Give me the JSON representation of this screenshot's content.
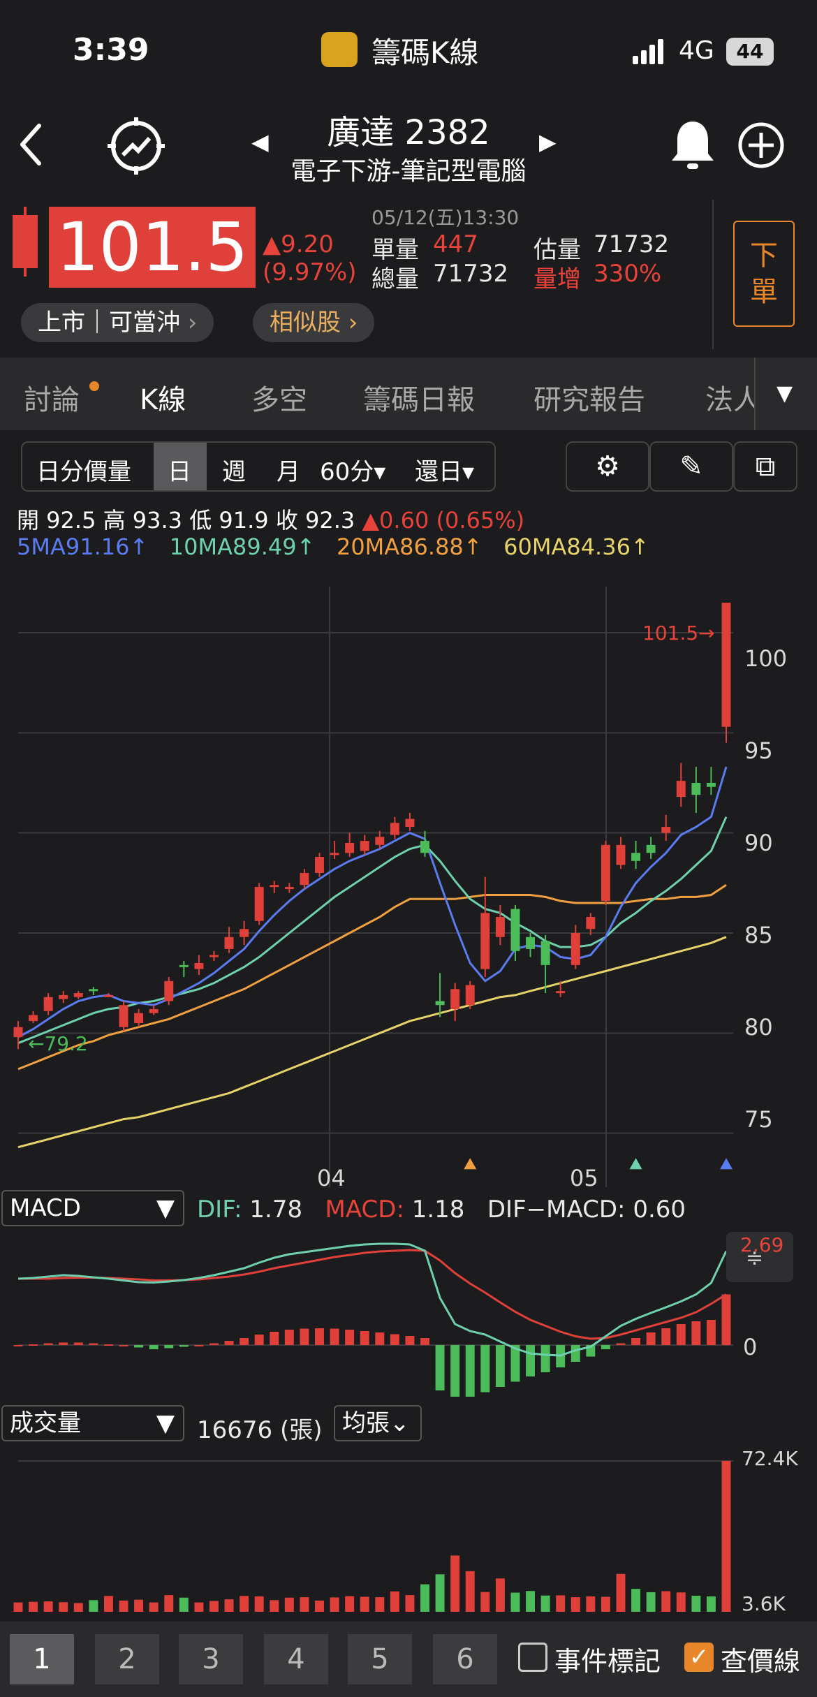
{
  "status_bar": {
    "time": "3:39",
    "app_name": "籌碼K線",
    "network": "4G",
    "battery": "44"
  },
  "header": {
    "stock_name": "廣達 2382",
    "industry": "電子下游-筆記型電腦"
  },
  "quote": {
    "price": "101.5",
    "change": "▲9.20",
    "change_pct": "(9.97%)",
    "datetime": "05/12(五)13:30",
    "single_vol_label": "單量",
    "single_vol": "447",
    "est_vol_label": "估量",
    "est_vol": "71732",
    "total_vol_label": "總量",
    "total_vol": "71732",
    "vol_increase_label": "量增",
    "vol_increase": "330%",
    "market_tag": "上市｜可當沖",
    "similar_label": "相似股",
    "order_button": "下單"
  },
  "tabs": [
    "討論",
    "K線",
    "多空",
    "籌碼日報",
    "研究報告",
    "法人"
  ],
  "toolbar": {
    "intraday": "日分價量",
    "day": "日",
    "week": "週",
    "month": "月",
    "minute": "60分▾",
    "restore": "還日▾"
  },
  "ohlc": {
    "open": "開 92.5",
    "high": "高 93.3",
    "low": "低 91.9",
    "close": "收 92.3",
    "change": "▲0.60 (0.65%)"
  },
  "ma_legend": {
    "ma5": "5MA91.16↑",
    "ma10": "10MA89.49↑",
    "ma20": "20MA86.88↑",
    "ma60": "60MA84.36↑"
  },
  "colors": {
    "up": "#e0403a",
    "down": "#4cbb5a",
    "ma5": "#5b7cf0",
    "ma10": "#6fd0b0",
    "ma20": "#f0a040",
    "ma60": "#e6d36a",
    "accent": "#e8862a"
  },
  "price_chart": {
    "y_ticks": [
      "100",
      "95",
      "90",
      "85",
      "80",
      "75"
    ],
    "x_ticks": [
      "04",
      "05"
    ],
    "last_price_marker": "101.5",
    "low_marker": "←79.2"
  },
  "macd": {
    "selector": "MACD",
    "dif_label": "DIF:",
    "dif_value": "1.78",
    "macd_label": "MACD:",
    "macd_value": "1.18",
    "diff_label": "DIF−MACD:",
    "diff_value": "0.60",
    "top_value": "2.69",
    "zero": "0"
  },
  "volume": {
    "selector": "成交量",
    "value": "16676 (張)",
    "unit_selector": "均張⌄",
    "max": "72.4K",
    "min": "3.6K"
  },
  "bottom": {
    "pages": [
      "1",
      "2",
      "3",
      "4",
      "5",
      "6"
    ],
    "event_marker": "事件標記",
    "price_line": "查價線"
  },
  "chart_data": {
    "type": "candlestick",
    "candles": [
      {
        "o": 79.8,
        "c": 80.3,
        "h": 80.6,
        "l": 79.2
      },
      {
        "o": 80.6,
        "c": 80.9,
        "h": 81.1,
        "l": 80.5
      },
      {
        "o": 81.1,
        "c": 81.8,
        "h": 82.0,
        "l": 80.9
      },
      {
        "o": 81.7,
        "c": 81.9,
        "h": 82.1,
        "l": 81.5
      },
      {
        "o": 81.8,
        "c": 82.0,
        "h": 82.1,
        "l": 81.7
      },
      {
        "o": 82.2,
        "c": 82.1,
        "h": 82.3,
        "l": 81.9
      },
      {
        "o": 81.9,
        "c": 81.9,
        "h": 82.0,
        "l": 81.8
      },
      {
        "o": 80.3,
        "c": 81.4,
        "h": 81.6,
        "l": 80.1
      },
      {
        "o": 80.5,
        "c": 81.0,
        "h": 81.2,
        "l": 80.3
      },
      {
        "o": 81.0,
        "c": 81.2,
        "h": 81.4,
        "l": 80.9
      },
      {
        "o": 81.6,
        "c": 82.6,
        "h": 82.8,
        "l": 81.4
      },
      {
        "o": 83.4,
        "c": 83.3,
        "h": 83.6,
        "l": 82.8
      },
      {
        "o": 83.2,
        "c": 83.5,
        "h": 83.9,
        "l": 82.9
      },
      {
        "o": 83.8,
        "c": 83.9,
        "h": 84.1,
        "l": 83.6
      },
      {
        "o": 84.2,
        "c": 84.8,
        "h": 85.3,
        "l": 84.0
      },
      {
        "o": 84.8,
        "c": 85.2,
        "h": 85.6,
        "l": 84.4
      },
      {
        "o": 85.6,
        "c": 87.3,
        "h": 87.5,
        "l": 85.4
      },
      {
        "o": 87.3,
        "c": 87.4,
        "h": 87.6,
        "l": 87.0
      },
      {
        "o": 87.2,
        "c": 87.3,
        "h": 87.5,
        "l": 87.0
      },
      {
        "o": 87.4,
        "c": 88.0,
        "h": 88.2,
        "l": 87.2
      },
      {
        "o": 88.0,
        "c": 88.8,
        "h": 89.0,
        "l": 87.8
      },
      {
        "o": 89.0,
        "c": 89.0,
        "h": 89.6,
        "l": 88.7
      },
      {
        "o": 89.0,
        "c": 89.5,
        "h": 90.0,
        "l": 88.8
      },
      {
        "o": 89.1,
        "c": 89.6,
        "h": 89.9,
        "l": 88.9
      },
      {
        "o": 89.4,
        "c": 89.8,
        "h": 90.1,
        "l": 89.2
      },
      {
        "o": 89.9,
        "c": 90.5,
        "h": 90.8,
        "l": 89.7
      },
      {
        "o": 90.3,
        "c": 90.7,
        "h": 91.0,
        "l": 90.1
      },
      {
        "o": 89.6,
        "c": 89.0,
        "h": 90.1,
        "l": 88.8
      },
      {
        "o": 81.6,
        "c": 81.4,
        "h": 83.0,
        "l": 80.8
      },
      {
        "o": 81.2,
        "c": 82.2,
        "h": 82.5,
        "l": 80.6
      },
      {
        "o": 81.4,
        "c": 82.4,
        "h": 82.6,
        "l": 81.2
      },
      {
        "o": 83.2,
        "c": 86.0,
        "h": 87.8,
        "l": 82.8
      },
      {
        "o": 84.8,
        "c": 85.8,
        "h": 86.4,
        "l": 84.4
      },
      {
        "o": 86.2,
        "c": 84.1,
        "h": 86.4,
        "l": 83.6
      },
      {
        "o": 84.8,
        "c": 84.2,
        "h": 85.0,
        "l": 83.8
      },
      {
        "o": 84.6,
        "c": 83.4,
        "h": 84.9,
        "l": 82.0
      },
      {
        "o": 82.0,
        "c": 82.1,
        "h": 82.6,
        "l": 81.8
      },
      {
        "o": 83.4,
        "c": 85.0,
        "h": 85.4,
        "l": 83.2
      },
      {
        "o": 85.2,
        "c": 85.8,
        "h": 86.0,
        "l": 84.9
      },
      {
        "o": 86.6,
        "c": 89.4,
        "h": 89.6,
        "l": 86.4
      },
      {
        "o": 88.4,
        "c": 89.4,
        "h": 89.8,
        "l": 88.2
      },
      {
        "o": 89.0,
        "c": 88.6,
        "h": 89.6,
        "l": 88.2
      },
      {
        "o": 89.4,
        "c": 89.0,
        "h": 89.8,
        "l": 88.7
      },
      {
        "o": 90.0,
        "c": 90.3,
        "h": 90.9,
        "l": 89.6
      },
      {
        "o": 91.8,
        "c": 92.6,
        "h": 93.5,
        "l": 91.3
      },
      {
        "o": 92.5,
        "c": 91.9,
        "h": 93.3,
        "l": 91.0
      },
      {
        "o": 92.5,
        "c": 92.3,
        "h": 93.3,
        "l": 91.9
      },
      {
        "o": 95.3,
        "c": 101.5,
        "h": 101.5,
        "l": 94.5
      }
    ],
    "ma5": [
      79.8,
      80.2,
      80.7,
      81.2,
      81.6,
      81.8,
      81.9,
      81.6,
      81.5,
      81.4,
      81.7,
      82.1,
      82.5,
      83.0,
      83.6,
      84.2,
      85.1,
      85.9,
      86.6,
      87.2,
      87.7,
      88.2,
      88.6,
      88.9,
      89.2,
      89.6,
      90.0,
      89.7,
      87.5,
      85.4,
      83.5,
      82.6,
      83.1,
      84.2,
      84.4,
      84.3,
      83.8,
      83.7,
      83.9,
      84.8,
      86.3,
      87.5,
      88.3,
      89.0,
      89.9,
      90.3,
      90.8,
      93.3
    ],
    "ma10": [
      79.5,
      79.8,
      80.1,
      80.4,
      80.7,
      81.0,
      81.2,
      81.3,
      81.5,
      81.6,
      81.8,
      82.0,
      82.2,
      82.5,
      82.9,
      83.3,
      83.8,
      84.4,
      85.0,
      85.6,
      86.2,
      86.8,
      87.3,
      87.8,
      88.3,
      88.8,
      89.2,
      89.4,
      88.6,
      87.6,
      86.7,
      86.2,
      86.0,
      85.5,
      85.1,
      84.6,
      84.3,
      84.3,
      84.4,
      84.8,
      85.5,
      86.0,
      86.6,
      87.1,
      87.7,
      88.4,
      89.1,
      90.8
    ],
    "ma20": [
      78.2,
      78.5,
      78.8,
      79.1,
      79.4,
      79.6,
      79.9,
      80.1,
      80.3,
      80.5,
      80.7,
      81.0,
      81.3,
      81.6,
      81.9,
      82.2,
      82.6,
      83.0,
      83.4,
      83.8,
      84.2,
      84.6,
      85.0,
      85.4,
      85.8,
      86.3,
      86.7,
      86.7,
      86.7,
      86.7,
      86.8,
      86.9,
      86.9,
      86.9,
      86.9,
      86.8,
      86.6,
      86.5,
      86.5,
      86.5,
      86.5,
      86.6,
      86.7,
      86.7,
      86.8,
      86.8,
      86.9,
      87.4
    ],
    "ma60": [
      74.3,
      74.5,
      74.7,
      74.9,
      75.1,
      75.3,
      75.5,
      75.7,
      75.8,
      76.0,
      76.2,
      76.4,
      76.6,
      76.8,
      77.0,
      77.3,
      77.6,
      77.9,
      78.2,
      78.5,
      78.8,
      79.1,
      79.4,
      79.7,
      80.0,
      80.3,
      80.6,
      80.8,
      81.0,
      81.2,
      81.4,
      81.6,
      81.8,
      81.9,
      82.1,
      82.3,
      82.5,
      82.7,
      82.9,
      83.1,
      83.3,
      83.5,
      83.7,
      83.9,
      84.1,
      84.3,
      84.5,
      84.8
    ],
    "event_markers": [
      {
        "index": 30,
        "color": "#f0a040"
      },
      {
        "index": 41,
        "color": "#6fd0b0"
      },
      {
        "index": 47,
        "color": "#5b7cf0"
      }
    ],
    "y_range": [
      73,
      103
    ],
    "macd_hist": [
      0.0,
      0.02,
      0.05,
      0.07,
      0.07,
      0.05,
      0.02,
      0.0,
      -0.07,
      -0.12,
      -0.09,
      -0.05,
      0.0,
      0.05,
      0.12,
      0.2,
      0.3,
      0.38,
      0.44,
      0.47,
      0.48,
      0.47,
      0.44,
      0.4,
      0.36,
      0.31,
      0.26,
      0.2,
      -1.3,
      -1.6,
      -1.5,
      -1.35,
      -1.2,
      -1.05,
      -0.9,
      -0.78,
      -0.64,
      -0.48,
      -0.33,
      -0.12,
      0.05,
      0.2,
      0.36,
      0.48,
      0.6,
      0.68,
      0.72,
      1.45
    ],
    "dif": [
      1.9,
      1.92,
      1.96,
      2.0,
      1.98,
      1.94,
      1.9,
      1.85,
      1.8,
      1.79,
      1.82,
      1.86,
      1.92,
      2.0,
      2.1,
      2.2,
      2.36,
      2.5,
      2.6,
      2.66,
      2.72,
      2.78,
      2.84,
      2.88,
      2.9,
      2.9,
      2.88,
      2.7,
      1.35,
      0.6,
      0.4,
      0.3,
      0.1,
      -0.1,
      -0.24,
      -0.28,
      -0.3,
      -0.15,
      -0.05,
      0.25,
      0.55,
      0.75,
      0.92,
      1.08,
      1.25,
      1.45,
      1.78,
      2.69
    ],
    "macd_line": [
      1.9,
      1.9,
      1.9,
      1.92,
      1.93,
      1.93,
      1.92,
      1.9,
      1.88,
      1.85,
      1.85,
      1.86,
      1.88,
      1.92,
      1.96,
      2.02,
      2.1,
      2.2,
      2.28,
      2.36,
      2.44,
      2.52,
      2.58,
      2.64,
      2.68,
      2.7,
      2.72,
      2.7,
      2.42,
      2.06,
      1.76,
      1.5,
      1.22,
      0.95,
      0.72,
      0.55,
      0.38,
      0.25,
      0.18,
      0.2,
      0.3,
      0.42,
      0.54,
      0.66,
      0.78,
      0.94,
      1.18,
      1.45
    ],
    "volume": [
      4.5,
      4.8,
      5.0,
      4.6,
      4.2,
      5.6,
      7.6,
      5.4,
      5.8,
      4.5,
      8.0,
      6.8,
      4.5,
      5.2,
      6.0,
      7.6,
      7.4,
      5.6,
      6.8,
      7.0,
      5.4,
      6.9,
      7.5,
      7.2,
      7.0,
      9.8,
      8.0,
      13.2,
      18.0,
      27.0,
      19.5,
      9.5,
      16.0,
      9.2,
      10.0,
      7.8,
      7.9,
      7.0,
      7.4,
      7.2,
      18.2,
      11.0,
      9.4,
      9.9,
      9.3,
      7.7,
      7.4,
      72.4
    ],
    "volume_range": [
      3.6,
      72.4
    ]
  }
}
